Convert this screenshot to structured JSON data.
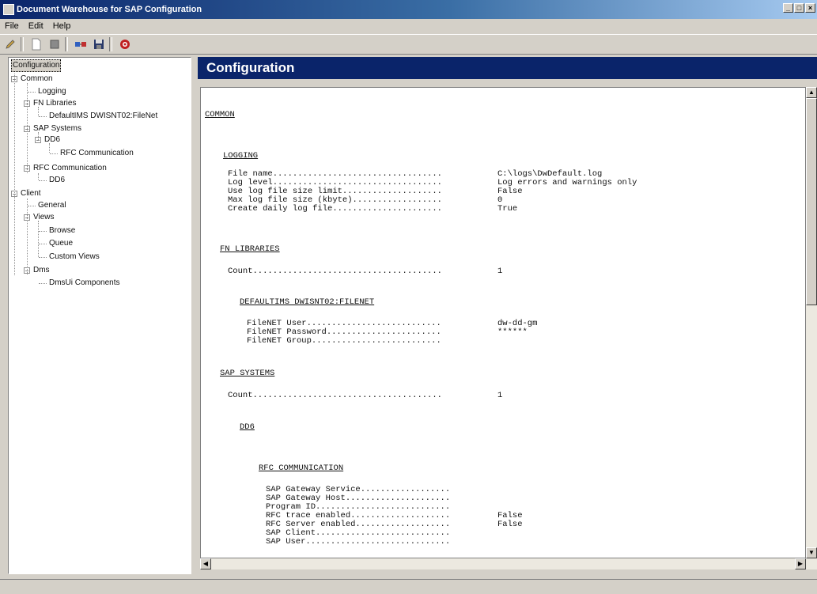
{
  "window": {
    "title": "Document Warehouse for SAP Configuration"
  },
  "menu": [
    "File",
    "Edit",
    "Help"
  ],
  "tree": {
    "root": "Configuration",
    "common": "Common",
    "logging": "Logging",
    "fn_libraries": "FN Libraries",
    "fn_lib_item": "DefaultIMS DWISNT02:FileNet",
    "sap_systems": "SAP Systems",
    "dd6": "DD6",
    "rfc_comm_child": "RFC Communication",
    "rfc_comm": "RFC Communication",
    "rfc_dd6": "DD6",
    "client": "Client",
    "general": "General",
    "views": "Views",
    "browse": "Browse",
    "queue": "Queue",
    "custom_views": "Custom Views",
    "dms": "Dms",
    "dmsui": "DmsUi Components"
  },
  "header": {
    "title": "Configuration"
  },
  "report": {
    "common": "COMMON",
    "logging": "LOGGING",
    "log_rows": [
      {
        "label": "File name..................................",
        "value": "C:\\logs\\DwDefault.log"
      },
      {
        "label": "Log level..................................",
        "value": "Log errors and warnings only"
      },
      {
        "label": "Use log file size limit....................",
        "value": "False"
      },
      {
        "label": "Max log file size (kbyte)..................",
        "value": "0"
      },
      {
        "label": "Create daily log file......................",
        "value": "True"
      }
    ],
    "fn_libraries": "FN LIBRARIES",
    "fn_count_label": "Count......................................",
    "fn_count_value": "1",
    "default_lib": "DEFAULTIMS DWISNT02:FILENET",
    "fn_rows": [
      {
        "label": "FileNET User...........................",
        "value": "dw-dd-gm"
      },
      {
        "label": "FileNET Password.......................",
        "value": "******"
      },
      {
        "label": "FileNET Group..........................",
        "value": ""
      }
    ],
    "sap_systems": "SAP SYSTEMS",
    "sap_count_label": "Count......................................",
    "sap_count_value": "1",
    "dd6": "DD6",
    "rfc_comm": "RFC COMMUNICATION",
    "rfc_rows": [
      {
        "label": "SAP Gateway Service..................",
        "value": ""
      },
      {
        "label": "SAP Gateway Host.....................",
        "value": ""
      },
      {
        "label": "Program ID...........................",
        "value": ""
      },
      {
        "label": "RFC trace enabled....................",
        "value": "False"
      },
      {
        "label": "RFC Server enabled...................",
        "value": "False"
      },
      {
        "label": "SAP Client...........................",
        "value": ""
      },
      {
        "label": "SAP User.............................",
        "value": ""
      }
    ]
  },
  "icons": {
    "toolbar": [
      "pencil-icon",
      "new-document-icon",
      "stop-icon",
      "connect-icon",
      "save-icon",
      "help-icon"
    ]
  }
}
